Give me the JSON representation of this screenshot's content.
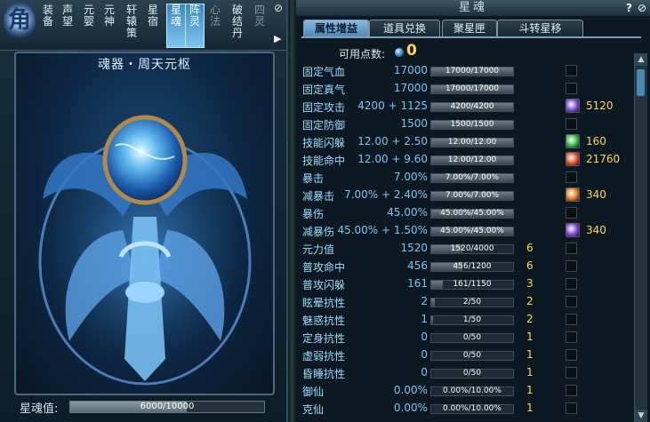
{
  "left_window": {
    "emblem_char": "角",
    "tabs": [
      {
        "label": "装备",
        "state": "normal"
      },
      {
        "label": "声望",
        "state": "normal"
      },
      {
        "label": "元婴",
        "state": "normal"
      },
      {
        "label": "元神",
        "state": "normal"
      },
      {
        "label": "轩辕策",
        "state": "normal"
      },
      {
        "label": "星宿",
        "state": "normal"
      },
      {
        "label": "星魂",
        "state": "active"
      },
      {
        "label": "阵灵",
        "state": "active"
      },
      {
        "label": "心法",
        "state": "dim"
      },
      {
        "label": "破结丹",
        "state": "normal"
      },
      {
        "label": "四灵",
        "state": "dim"
      }
    ],
    "artifact_title": "魂器・周天元枢",
    "soul_bar": {
      "label": "星魂值:",
      "text": "6000/10000",
      "fraction": 0.6
    }
  },
  "right_window": {
    "title": "星魂",
    "tabs": [
      {
        "label": "属性增益",
        "active": true
      },
      {
        "label": "道具兑换",
        "active": false
      },
      {
        "label": "聚星匣",
        "active": false
      },
      {
        "label": "斗转星移",
        "active": false
      }
    ],
    "points_label": "可用点数:",
    "points_value": "0",
    "stats": [
      {
        "name": "固定气血",
        "value": "17000",
        "bar_text": "17000/17000",
        "bar_fraction": 1.0,
        "count": "",
        "gem": "",
        "cost": ""
      },
      {
        "name": "固定真气",
        "value": "17000",
        "bar_text": "17000/17000",
        "bar_fraction": 1.0,
        "count": "",
        "gem": "",
        "cost": ""
      },
      {
        "name": "固定攻击",
        "value": "4200 + 1125",
        "bar_text": "4200/4200",
        "bar_fraction": 1.0,
        "count": "",
        "gem": "purple",
        "cost": "5120"
      },
      {
        "name": "固定防御",
        "value": "1500",
        "bar_text": "1500/1500",
        "bar_fraction": 1.0,
        "count": "",
        "gem": "",
        "cost": ""
      },
      {
        "name": "技能闪躲",
        "value": "12.00 + 2.50",
        "bar_text": "12.00/12.00",
        "bar_fraction": 1.0,
        "count": "",
        "gem": "green",
        "cost": "160"
      },
      {
        "name": "技能命中",
        "value": "12.00 + 9.60",
        "bar_text": "12.00/12.00",
        "bar_fraction": 1.0,
        "count": "",
        "gem": "red",
        "cost": "21760"
      },
      {
        "name": "暴击",
        "value": "7.00%",
        "bar_text": "7.00%/7.00%",
        "bar_fraction": 1.0,
        "count": "",
        "gem": "",
        "cost": ""
      },
      {
        "name": "减暴击",
        "value": "7.00% + 2.40%",
        "bar_text": "7.00%/7.00%",
        "bar_fraction": 1.0,
        "count": "",
        "gem": "orange",
        "cost": "340"
      },
      {
        "name": "暴伤",
        "value": "45.00%",
        "bar_text": "45.00%/45.00%",
        "bar_fraction": 1.0,
        "count": "",
        "gem": "",
        "cost": ""
      },
      {
        "name": "减暴伤",
        "value": "45.00% + 1.50%",
        "bar_text": "45.00%/45.00%",
        "bar_fraction": 1.0,
        "count": "",
        "gem": "purple",
        "cost": "340"
      },
      {
        "name": "元力值",
        "value": "1520",
        "bar_text": "1520/4000",
        "bar_fraction": 0.38,
        "count": "6",
        "gem": "",
        "cost": ""
      },
      {
        "name": "普攻命中",
        "value": "456",
        "bar_text": "456/1200",
        "bar_fraction": 0.38,
        "count": "6",
        "gem": "",
        "cost": ""
      },
      {
        "name": "普攻闪躲",
        "value": "161",
        "bar_text": "161/1150",
        "bar_fraction": 0.14,
        "count": "3",
        "gem": "",
        "cost": ""
      },
      {
        "name": "眩晕抗性",
        "value": "2",
        "bar_text": "2/50",
        "bar_fraction": 0.04,
        "count": "2",
        "gem": "",
        "cost": ""
      },
      {
        "name": "魅惑抗性",
        "value": "1",
        "bar_text": "1/50",
        "bar_fraction": 0.02,
        "count": "2",
        "gem": "",
        "cost": ""
      },
      {
        "name": "定身抗性",
        "value": "0",
        "bar_text": "0/50",
        "bar_fraction": 0.0,
        "count": "1",
        "gem": "",
        "cost": ""
      },
      {
        "name": "虚弱抗性",
        "value": "0",
        "bar_text": "0/50",
        "bar_fraction": 0.0,
        "count": "1",
        "gem": "",
        "cost": ""
      },
      {
        "name": "昏睡抗性",
        "value": "0",
        "bar_text": "0/50",
        "bar_fraction": 0.0,
        "count": "1",
        "gem": "",
        "cost": ""
      },
      {
        "name": "御仙",
        "value": "0.00%",
        "bar_text": "0.00%/10.00%",
        "bar_fraction": 0.0,
        "count": "1",
        "gem": "",
        "cost": ""
      },
      {
        "name": "克仙",
        "value": "0.00%",
        "bar_text": "0.00%/10.00%",
        "bar_fraction": 0.0,
        "count": "1",
        "gem": "",
        "cost": ""
      }
    ]
  },
  "colors": {
    "stat_name": "#9edcff",
    "stat_value": "#7fc4f0",
    "gold": "#ffdd55",
    "gem_purple": "#7b45d6",
    "gem_green": "#2fbb3c",
    "gem_red": "#e24a24",
    "gem_orange": "#e07a1c"
  }
}
